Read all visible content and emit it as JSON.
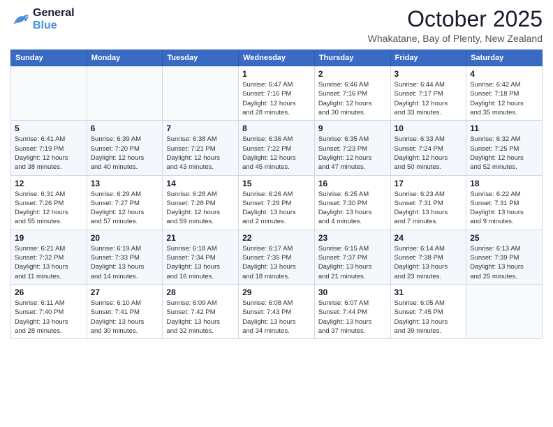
{
  "logo": {
    "line1": "General",
    "line2": "Blue"
  },
  "title": "October 2025",
  "location": "Whakatane, Bay of Plenty, New Zealand",
  "weekdays": [
    "Sunday",
    "Monday",
    "Tuesday",
    "Wednesday",
    "Thursday",
    "Friday",
    "Saturday"
  ],
  "weeks": [
    [
      {
        "day": "",
        "info": ""
      },
      {
        "day": "",
        "info": ""
      },
      {
        "day": "",
        "info": ""
      },
      {
        "day": "1",
        "info": "Sunrise: 6:47 AM\nSunset: 7:16 PM\nDaylight: 12 hours\nand 28 minutes."
      },
      {
        "day": "2",
        "info": "Sunrise: 6:46 AM\nSunset: 7:16 PM\nDaylight: 12 hours\nand 30 minutes."
      },
      {
        "day": "3",
        "info": "Sunrise: 6:44 AM\nSunset: 7:17 PM\nDaylight: 12 hours\nand 33 minutes."
      },
      {
        "day": "4",
        "info": "Sunrise: 6:42 AM\nSunset: 7:18 PM\nDaylight: 12 hours\nand 35 minutes."
      }
    ],
    [
      {
        "day": "5",
        "info": "Sunrise: 6:41 AM\nSunset: 7:19 PM\nDaylight: 12 hours\nand 38 minutes."
      },
      {
        "day": "6",
        "info": "Sunrise: 6:39 AM\nSunset: 7:20 PM\nDaylight: 12 hours\nand 40 minutes."
      },
      {
        "day": "7",
        "info": "Sunrise: 6:38 AM\nSunset: 7:21 PM\nDaylight: 12 hours\nand 43 minutes."
      },
      {
        "day": "8",
        "info": "Sunrise: 6:36 AM\nSunset: 7:22 PM\nDaylight: 12 hours\nand 45 minutes."
      },
      {
        "day": "9",
        "info": "Sunrise: 6:35 AM\nSunset: 7:23 PM\nDaylight: 12 hours\nand 47 minutes."
      },
      {
        "day": "10",
        "info": "Sunrise: 6:33 AM\nSunset: 7:24 PM\nDaylight: 12 hours\nand 50 minutes."
      },
      {
        "day": "11",
        "info": "Sunrise: 6:32 AM\nSunset: 7:25 PM\nDaylight: 12 hours\nand 52 minutes."
      }
    ],
    [
      {
        "day": "12",
        "info": "Sunrise: 6:31 AM\nSunset: 7:26 PM\nDaylight: 12 hours\nand 55 minutes."
      },
      {
        "day": "13",
        "info": "Sunrise: 6:29 AM\nSunset: 7:27 PM\nDaylight: 12 hours\nand 57 minutes."
      },
      {
        "day": "14",
        "info": "Sunrise: 6:28 AM\nSunset: 7:28 PM\nDaylight: 12 hours\nand 59 minutes."
      },
      {
        "day": "15",
        "info": "Sunrise: 6:26 AM\nSunset: 7:29 PM\nDaylight: 13 hours\nand 2 minutes."
      },
      {
        "day": "16",
        "info": "Sunrise: 6:25 AM\nSunset: 7:30 PM\nDaylight: 13 hours\nand 4 minutes."
      },
      {
        "day": "17",
        "info": "Sunrise: 6:23 AM\nSunset: 7:31 PM\nDaylight: 13 hours\nand 7 minutes."
      },
      {
        "day": "18",
        "info": "Sunrise: 6:22 AM\nSunset: 7:31 PM\nDaylight: 13 hours\nand 9 minutes."
      }
    ],
    [
      {
        "day": "19",
        "info": "Sunrise: 6:21 AM\nSunset: 7:32 PM\nDaylight: 13 hours\nand 11 minutes."
      },
      {
        "day": "20",
        "info": "Sunrise: 6:19 AM\nSunset: 7:33 PM\nDaylight: 13 hours\nand 14 minutes."
      },
      {
        "day": "21",
        "info": "Sunrise: 6:18 AM\nSunset: 7:34 PM\nDaylight: 13 hours\nand 16 minutes."
      },
      {
        "day": "22",
        "info": "Sunrise: 6:17 AM\nSunset: 7:35 PM\nDaylight: 13 hours\nand 18 minutes."
      },
      {
        "day": "23",
        "info": "Sunrise: 6:15 AM\nSunset: 7:37 PM\nDaylight: 13 hours\nand 21 minutes."
      },
      {
        "day": "24",
        "info": "Sunrise: 6:14 AM\nSunset: 7:38 PM\nDaylight: 13 hours\nand 23 minutes."
      },
      {
        "day": "25",
        "info": "Sunrise: 6:13 AM\nSunset: 7:39 PM\nDaylight: 13 hours\nand 25 minutes."
      }
    ],
    [
      {
        "day": "26",
        "info": "Sunrise: 6:11 AM\nSunset: 7:40 PM\nDaylight: 13 hours\nand 28 minutes."
      },
      {
        "day": "27",
        "info": "Sunrise: 6:10 AM\nSunset: 7:41 PM\nDaylight: 13 hours\nand 30 minutes."
      },
      {
        "day": "28",
        "info": "Sunrise: 6:09 AM\nSunset: 7:42 PM\nDaylight: 13 hours\nand 32 minutes."
      },
      {
        "day": "29",
        "info": "Sunrise: 6:08 AM\nSunset: 7:43 PM\nDaylight: 13 hours\nand 34 minutes."
      },
      {
        "day": "30",
        "info": "Sunrise: 6:07 AM\nSunset: 7:44 PM\nDaylight: 13 hours\nand 37 minutes."
      },
      {
        "day": "31",
        "info": "Sunrise: 6:05 AM\nSunset: 7:45 PM\nDaylight: 13 hours\nand 39 minutes."
      },
      {
        "day": "",
        "info": ""
      }
    ]
  ]
}
